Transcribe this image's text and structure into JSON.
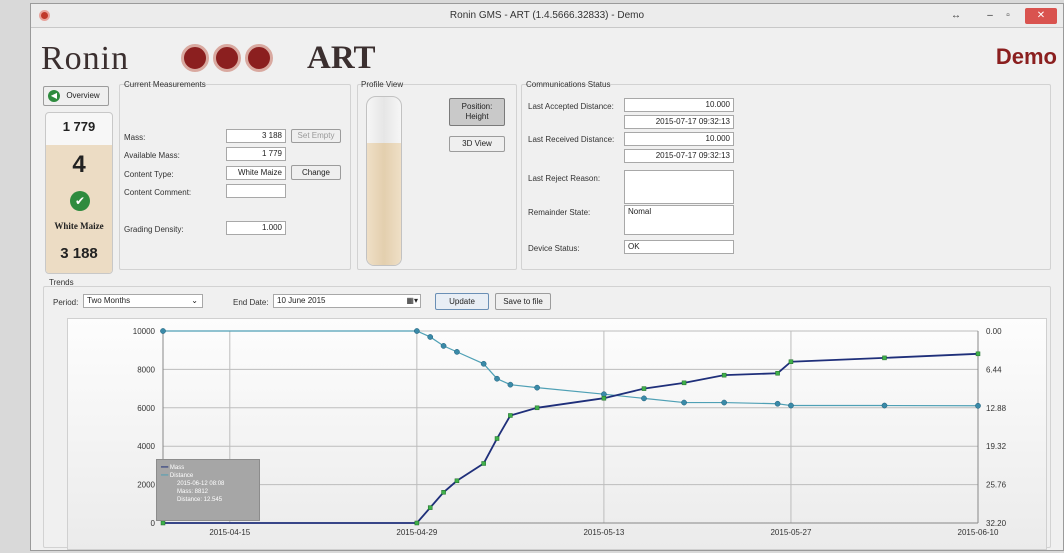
{
  "window": {
    "title": "Ronin GMS - ART (1.4.5666.32833) - Demo",
    "controls": {
      "restore": "↔",
      "minimize": "–",
      "maximize": "▫",
      "close": "✕"
    }
  },
  "header": {
    "logo_text": "Ronin",
    "art_text": "ART",
    "mode_label": "Demo"
  },
  "overview_button": "Overview",
  "silo": {
    "available": "1 779",
    "number": "4",
    "content": "White Maize",
    "mass": "3 188"
  },
  "current": {
    "group_label": "Current Measurements",
    "mass_label": "Mass:",
    "mass_value": "3 188",
    "set_empty": "Set Empty",
    "available_label": "Available Mass:",
    "available_value": "1 779",
    "content_type_label": "Content Type:",
    "content_type_value": "White Maize",
    "change": "Change",
    "content_comment_label": "Content Comment:",
    "content_comment_value": "",
    "grading_label": "Grading Density:",
    "grading_value": "1.000"
  },
  "profile": {
    "group_label": "Profile View",
    "position_height": "Position: Height",
    "view_3d": "3D View"
  },
  "comms": {
    "group_label": "Communications Status",
    "accepted_label": "Last Accepted Distance:",
    "accepted_value": "10.000",
    "accepted_time": "2015-07-17 09:32:13",
    "received_label": "Last Received Distance:",
    "received_value": "10.000",
    "received_time": "2015-07-17 09:32:13",
    "reject_label": "Last Reject Reason:",
    "reject_value": "",
    "remainder_label": "Remainder State:",
    "remainder_value": "Nomal",
    "device_label": "Device Status:",
    "device_value": "OK"
  },
  "trends": {
    "group_label": "Trends",
    "period_label": "Period:",
    "period_value": "Two Months",
    "end_date_label": "End Date:",
    "end_date_value": "10   June   2015",
    "update": "Update",
    "save": "Save to file"
  },
  "colors": {
    "mass": "#1f2f7a",
    "distance": "#4fa0b5",
    "accent": "#8b1f1f",
    "point": "#3fb04a"
  },
  "chart_data": {
    "type": "line",
    "x": [
      "2015-04-10",
      "2015-04-29",
      "2015-04-30",
      "2015-05-01",
      "2015-05-02",
      "2015-05-04",
      "2015-05-05",
      "2015-05-06",
      "2015-05-08",
      "2015-05-13",
      "2015-05-16",
      "2015-05-19",
      "2015-05-22",
      "2015-05-26",
      "2015-05-27",
      "2015-06-03",
      "2015-06-10"
    ],
    "series": [
      {
        "name": "Mass",
        "axis": "left",
        "values": [
          0,
          0,
          800,
          1600,
          2200,
          3100,
          4400,
          5600,
          6000,
          6500,
          7000,
          7300,
          7700,
          7800,
          8400,
          8600,
          8812
        ]
      },
      {
        "name": "Distance",
        "axis": "right",
        "values": [
          0.0,
          0.0,
          1.0,
          2.5,
          3.5,
          5.5,
          8.0,
          9.0,
          9.5,
          10.6,
          11.3,
          12.0,
          12.0,
          12.2,
          12.5,
          12.5,
          12.54
        ]
      }
    ],
    "xticks": [
      "2015-04-15",
      "2015-04-29",
      "2015-05-13",
      "2015-05-27",
      "2015-06-10"
    ],
    "yticks_left": [
      "0",
      "2000",
      "4000",
      "6000",
      "8000",
      "10000"
    ],
    "yticks_right": [
      "0.00",
      "6.44",
      "12.88",
      "19.32",
      "25.76",
      "32.20"
    ],
    "ylim_left": [
      0,
      10000
    ],
    "ylim_right": [
      32.2,
      0.0
    ],
    "grid": true,
    "legend": {
      "position": "bottom-left",
      "entries": [
        "Mass",
        "Distance"
      ],
      "info": [
        "2015-06-12 08:08",
        "Mass: 8812",
        "Distance: 12.545"
      ]
    }
  }
}
